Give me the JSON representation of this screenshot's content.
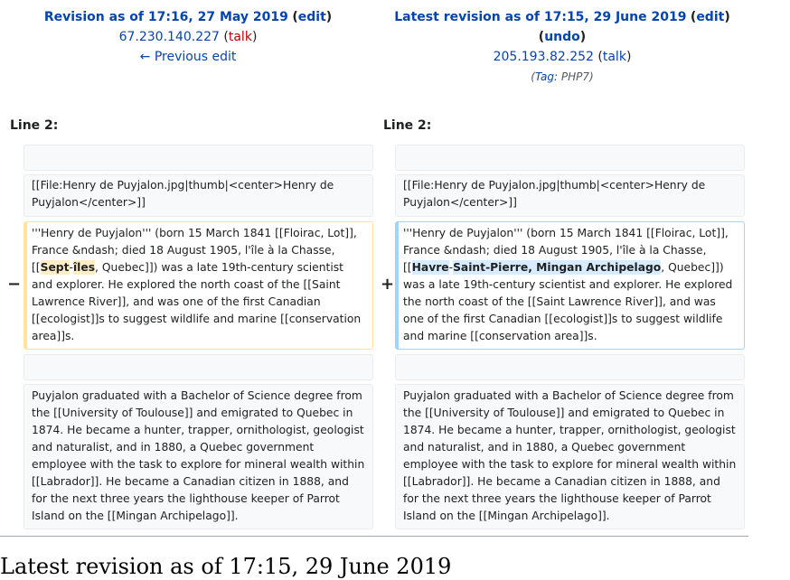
{
  "left_header": {
    "title": "Revision as of 17:16, 27 May 2019",
    "edit_label": "edit",
    "user": "67.230.140.227",
    "talk_label": "talk",
    "prev_edit_label": "← Previous edit"
  },
  "right_header": {
    "title": "Latest revision as of 17:15, 29 June 2019",
    "edit_label": "edit",
    "undo_label": "undo",
    "user": "205.193.82.252",
    "talk_label": "talk",
    "tag_label": "Tag:",
    "tag_value": "PHP7"
  },
  "line_label": "Line 2:",
  "markers": {
    "minus": "−",
    "plus": "+"
  },
  "context_file": "[[File:Henry de Puyjalon.jpg|thumb|<center>Henry de Puyjalon</center>]]",
  "changed_left": {
    "before": "'''Henry de Puyjalon''' (born 15 March 1841 [[Floirac, Lot]], France &ndash; died 18 August 1905, l'île à la Chasse, [[",
    "hl1": "Sept",
    "sep": "-",
    "hl2": "îles",
    "after": ", Quebec]]) was a late 19th-century scientist and explorer. He explored the north coast of the [[Saint Lawrence River]], and was one of the first Canadian [[ecologist]]s to suggest wildlife and marine [[conservation area]]s."
  },
  "changed_right": {
    "before": "'''Henry de Puyjalon''' (born 15 March 1841 [[Floirac, Lot]], France &ndash; died 18 August 1905, l'île à la Chasse, [[",
    "hl1": "Havre",
    "sep": "-",
    "hl2": "Saint-Pierre, Mingan Archipelago",
    "after": ", Quebec]]) was a late 19th-century scientist and explorer. He explored the north coast of the [[Saint Lawrence River]], and was one of the first Canadian [[ecologist]]s to suggest wildlife and marine [[conservation area]]s."
  },
  "context_paragraph": "Puyjalon graduated with a Bachelor of Science degree from the [[University of Toulouse]] and emigrated to Quebec in 1874. He became a hunter, trapper, ornithologist, geologist and naturalist, and in 1880, a Quebec government employee with the task to explore for mineral wealth within [[Labrador]]. He became a Canadian citizen in 1888, and for the next three years the lighthouse keeper of Parrot Island on the [[Mingan Archipelago]].",
  "bottom_heading": "Latest revision as of 17:15, 29 June 2019"
}
